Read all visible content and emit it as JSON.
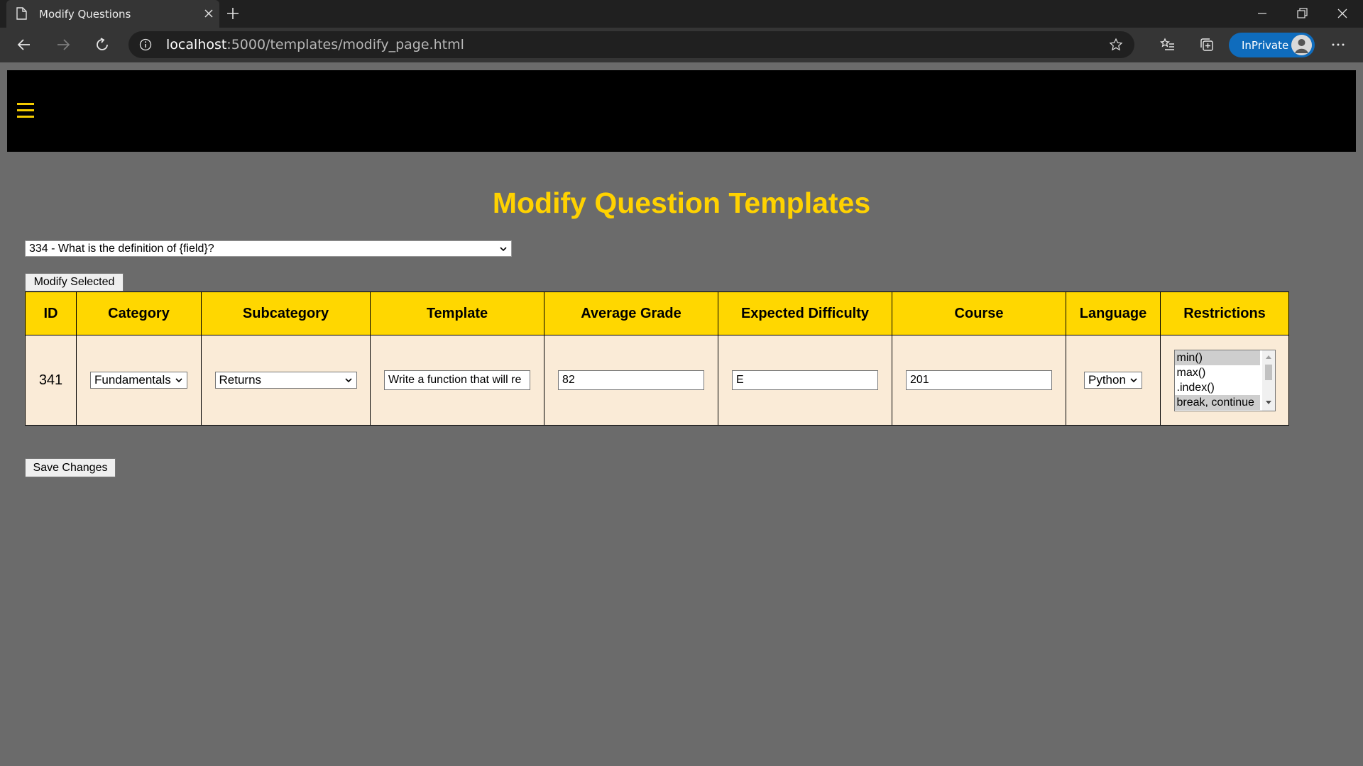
{
  "browser": {
    "tab_title": "Modify Questions",
    "url_host": "localhost",
    "url_path": ":5000/templates/modify_page.html",
    "inprivate_label": "InPrivate"
  },
  "page": {
    "title": "Modify Question Templates",
    "template_select_value": "334 - What is the definition of {field}?",
    "modify_button": "Modify Selected",
    "save_button": "Save Changes"
  },
  "table": {
    "headers": [
      "ID",
      "Category",
      "Subcategory",
      "Template",
      "Average Grade",
      "Expected Difficulty",
      "Course",
      "Language",
      "Restrictions"
    ],
    "row": {
      "id": "341",
      "category": "Fundamentals",
      "subcategory": "Returns",
      "template": "Write a function that will re",
      "average_grade": "82",
      "expected_difficulty": "E",
      "course": "201",
      "language": "Python",
      "restrictions": [
        "min()",
        "max()",
        ".index()",
        "break, continue"
      ],
      "restrictions_selected": [
        "min()",
        "break, continue"
      ]
    }
  },
  "colors": {
    "page_bg": "#6b6b6b",
    "header_bg": "#000000",
    "accent_yellow": "#ffd200",
    "table_header_bg": "#ffd700",
    "table_cell_bg": "#faebd7"
  },
  "icons": {
    "tab": "page-icon",
    "nav": [
      "back-arrow-icon",
      "forward-arrow-icon",
      "refresh-icon"
    ],
    "menu": "hamburger-icon"
  }
}
